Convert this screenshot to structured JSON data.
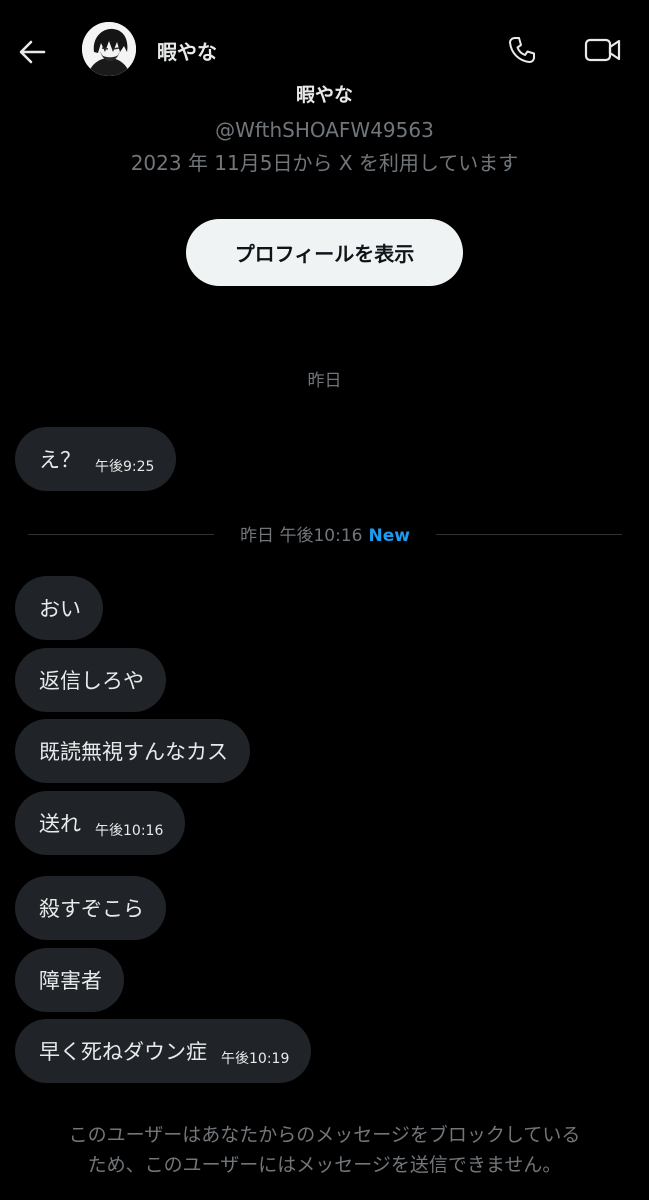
{
  "header": {
    "back_icon": "arrow-left-icon",
    "name": "暇やな",
    "call_icon": "phone-icon",
    "video_icon": "video-camera-icon"
  },
  "profile": {
    "name": "暇やな",
    "handle": "@WfthSHOAFW49563",
    "joined": "2023 年 11月5日から X を利用しています",
    "view_profile_label": "プロフィールを表示"
  },
  "conversation": {
    "date_label": "昨日",
    "divider": {
      "text": "昨日 午後10:16",
      "new_label": "New"
    },
    "messages": [
      {
        "text": "え？",
        "time": "午後9:25"
      },
      {
        "text": "おい",
        "time": ""
      },
      {
        "text": "返信しろや",
        "time": ""
      },
      {
        "text": "既読無視すんなカス",
        "time": ""
      },
      {
        "text": "送れ",
        "time": "午後10:16"
      },
      {
        "text": "殺すぞこら",
        "time": ""
      },
      {
        "text": "障害者",
        "time": ""
      },
      {
        "text": "早く死ねダウン症",
        "time": "午後10:19"
      }
    ]
  },
  "footer": {
    "notice_line1": "このユーザーはあなたからのメッセージをブロックしている",
    "notice_line2": "ため、このユーザーにはメッセージを送信できません。"
  },
  "colors": {
    "background": "#000000",
    "bubble": "#202327",
    "muted_text": "#71767b",
    "accent": "#1d9bf0",
    "button_bg": "#eff3f4"
  }
}
